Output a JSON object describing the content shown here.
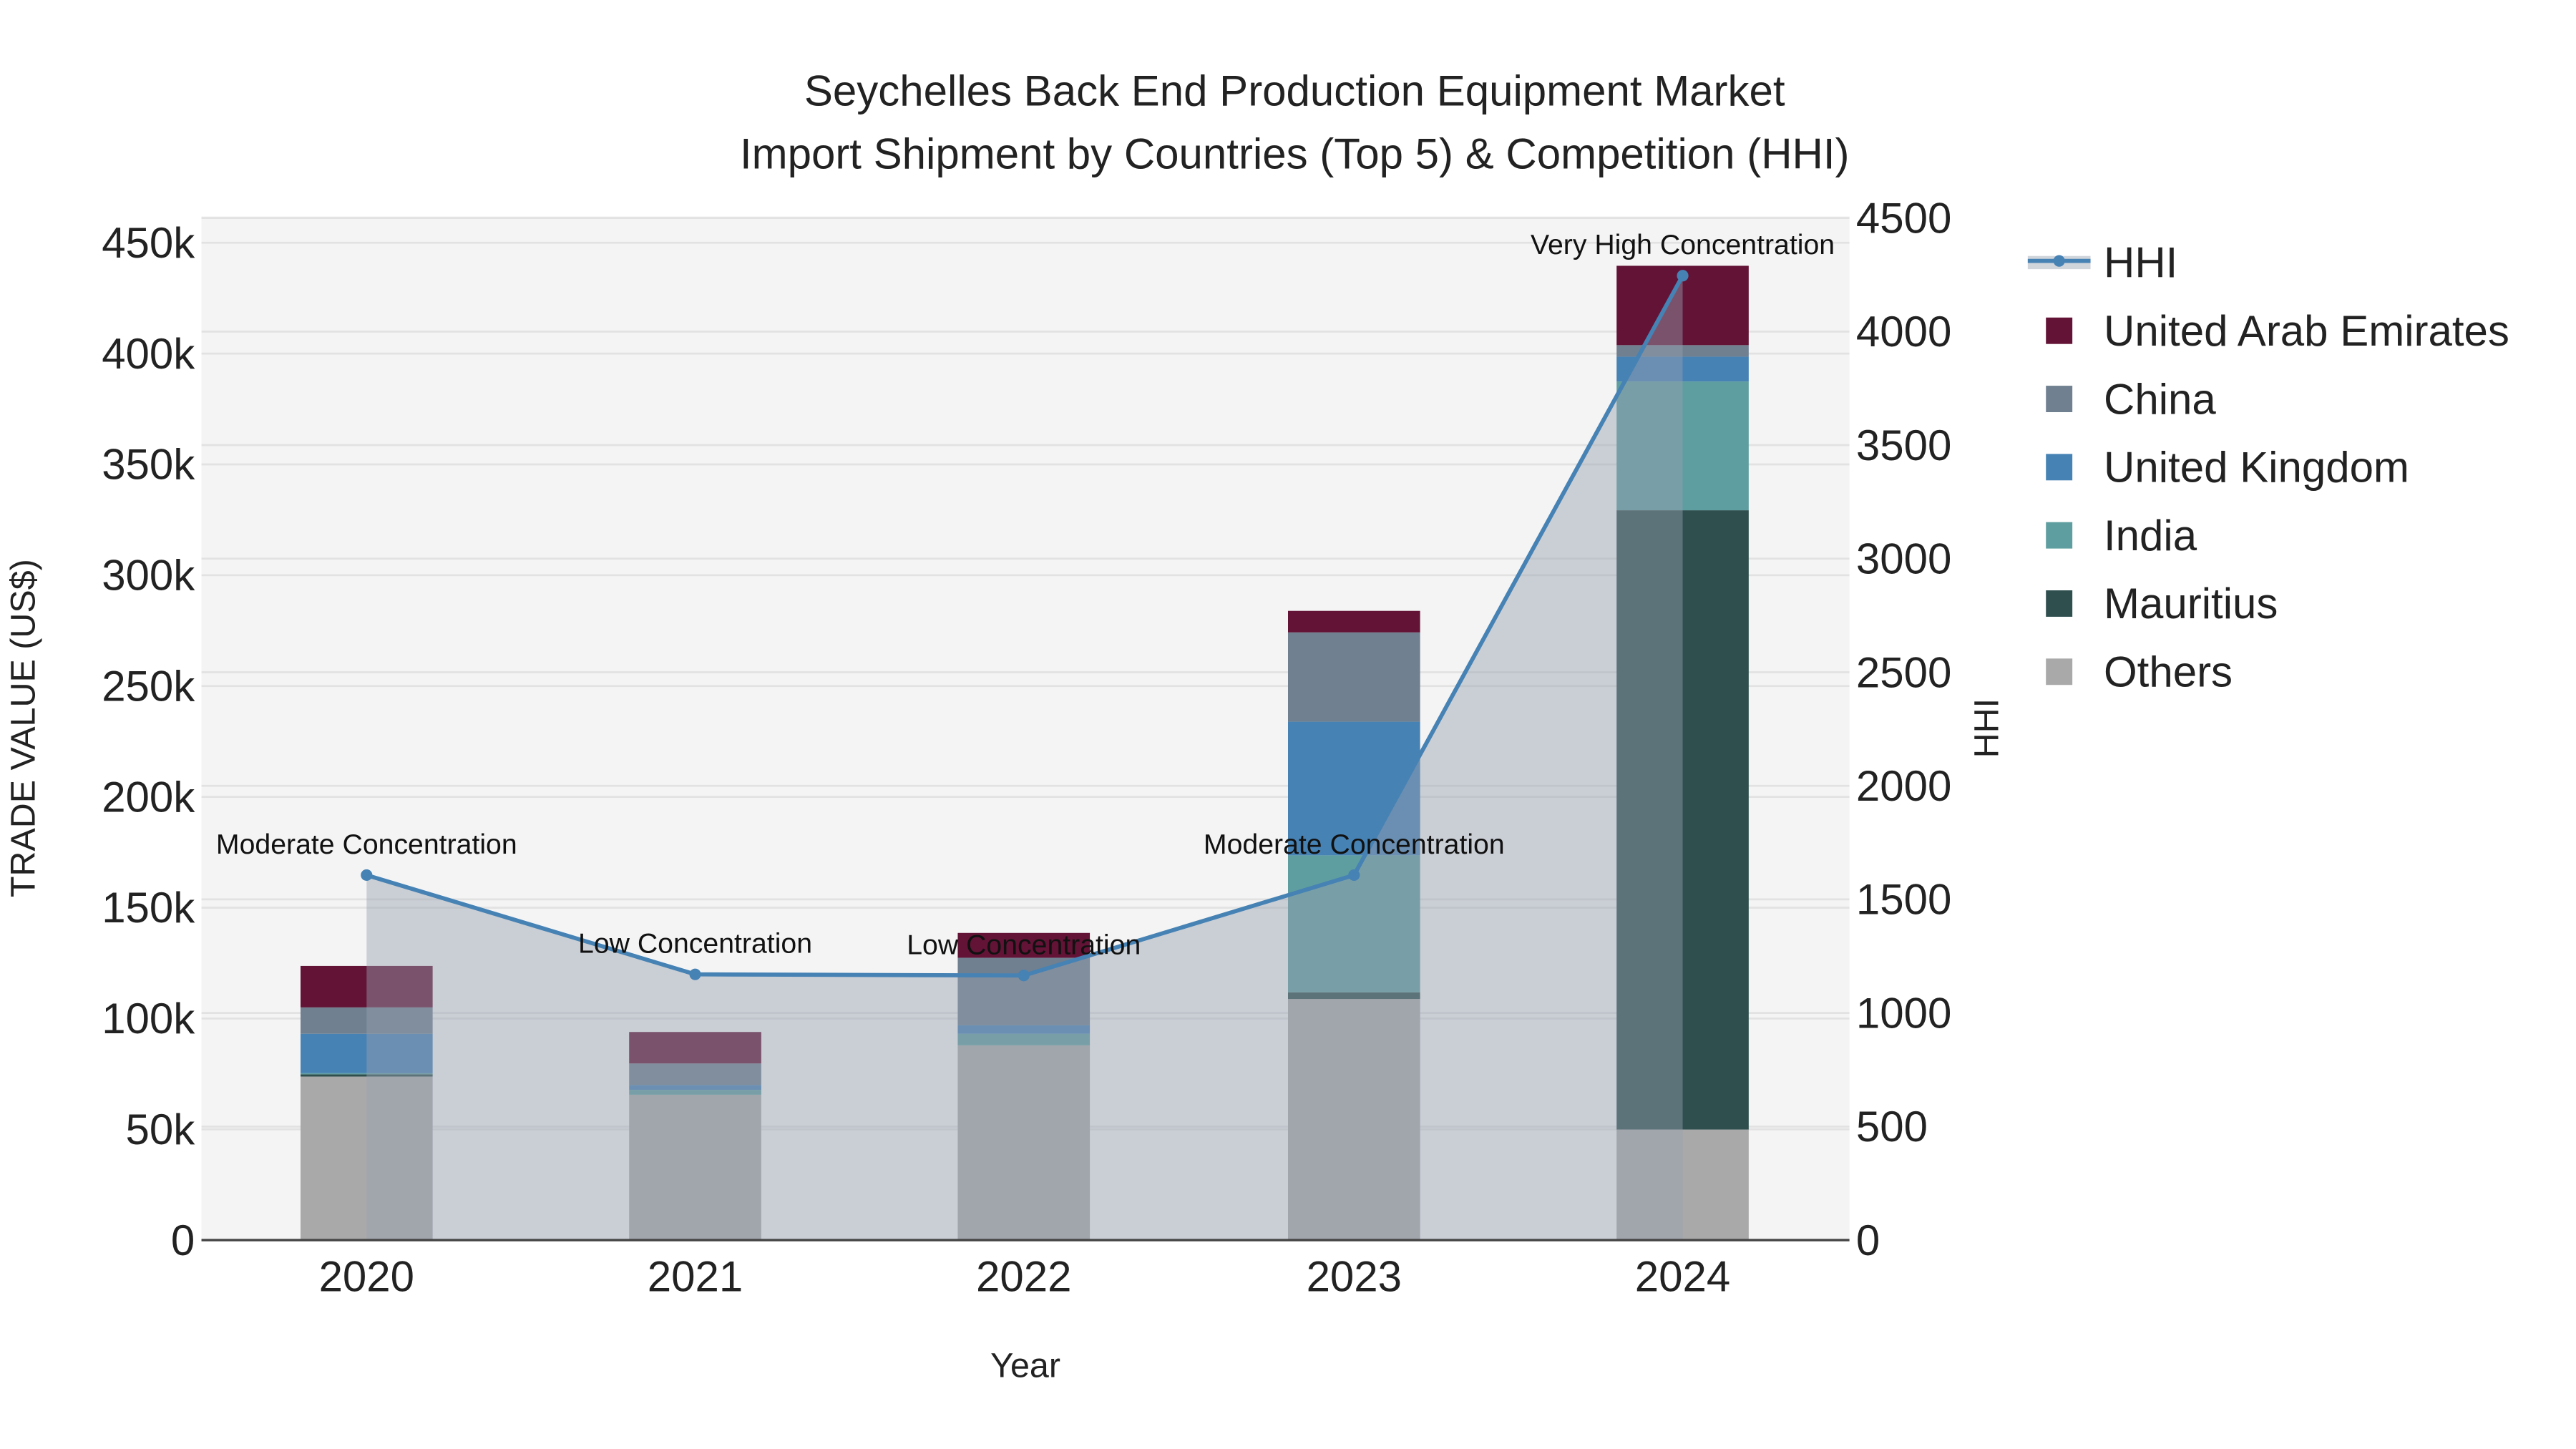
{
  "chart_data": {
    "type": "bar",
    "title": "Seychelles Back End Production Equipment Market",
    "subtitle": "Import Shipment by Countries (Top 5) & Competition (HHI)",
    "xlabel": "Year",
    "ylabel": "TRADE VALUE (US$)",
    "y2label": "HHI",
    "categories": [
      "2020",
      "2021",
      "2022",
      "2023",
      "2024"
    ],
    "ylim": [
      0,
      450000
    ],
    "y2lim": [
      0,
      4500
    ],
    "yticks": [
      "0",
      "50k",
      "100k",
      "150k",
      "200k",
      "250k",
      "300k",
      "350k",
      "400k",
      "450k"
    ],
    "y2ticks": [
      "0",
      "500",
      "1000",
      "1500",
      "2000",
      "2500",
      "3000",
      "3500",
      "4000",
      "4500"
    ],
    "stacked": true,
    "series": [
      {
        "name": "Others",
        "color": "#a9a9a9",
        "values": [
          73800,
          65600,
          87900,
          108800,
          49900
        ]
      },
      {
        "name": "Mauritius",
        "color": "#2f4f4f",
        "values": [
          1000,
          0,
          0,
          3000,
          279400
        ]
      },
      {
        "name": "India",
        "color": "#5f9ea0",
        "values": [
          500,
          2200,
          5200,
          61800,
          58100
        ]
      },
      {
        "name": "United Kingdom",
        "color": "#4682b4",
        "values": [
          17800,
          2200,
          3800,
          60300,
          11200
        ]
      },
      {
        "name": "China",
        "color": "#708090",
        "values": [
          11900,
          9700,
          30500,
          40300,
          5200
        ]
      },
      {
        "name": "United Arab Emirates",
        "color": "#631336",
        "values": [
          18700,
          14200,
          11200,
          9700,
          35800
        ]
      }
    ],
    "line": {
      "name": "HHI",
      "color": "#4682b4",
      "values": [
        1607,
        1170,
        1165,
        1607,
        4246
      ]
    },
    "annotations": [
      "Moderate Concentration",
      "Low Concentration",
      "Low Concentration",
      "Moderate Concentration",
      "Very High Concentration"
    ],
    "legend_order": [
      "HHI",
      "United Arab Emirates",
      "China",
      "United Kingdom",
      "India",
      "Mauritius",
      "Others"
    ],
    "legend_position": "right",
    "grid": true
  }
}
